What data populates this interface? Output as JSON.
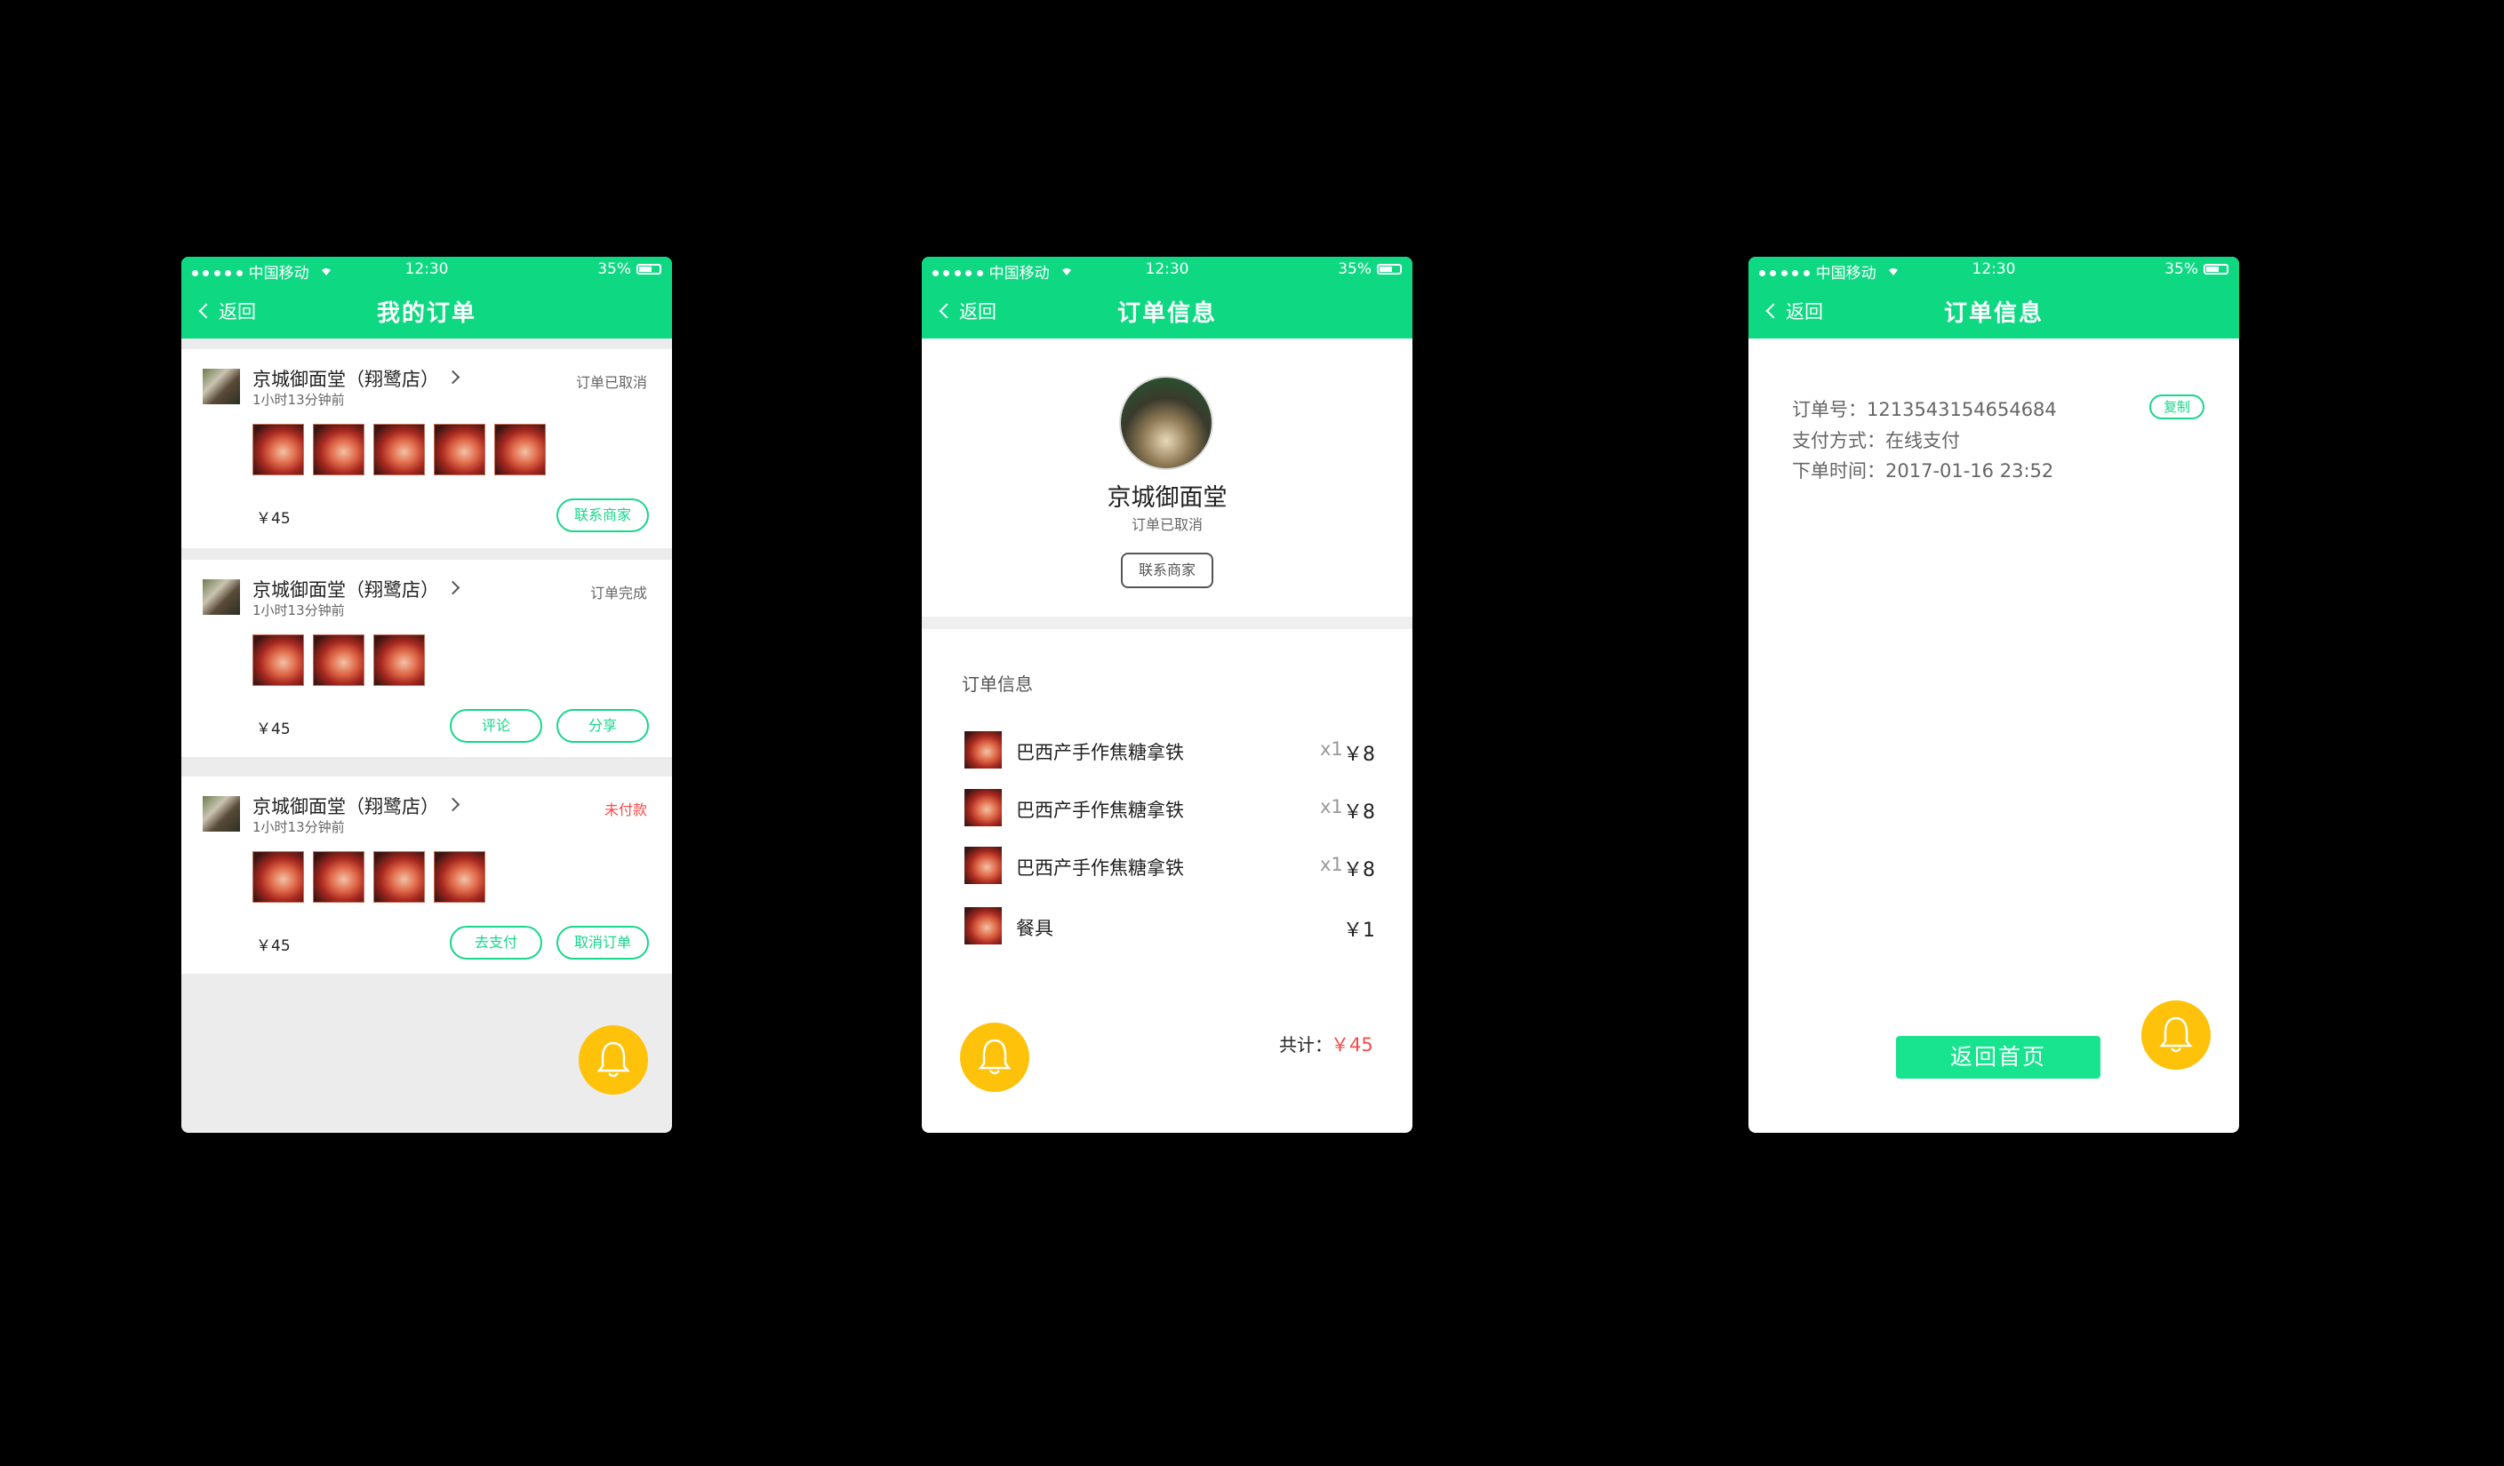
{
  "status_bar": {
    "carrier": "中国移动",
    "time": "12:30",
    "battery": "35%"
  },
  "back_label": "返回",
  "screen1": {
    "title": "我的订单",
    "orders": [
      {
        "shop": "京城御面堂（翔鹭店）",
        "time": "1小时13分钟前",
        "status": "订单已取消",
        "price": "￥45",
        "buttons": [
          "联系商家"
        ]
      },
      {
        "shop": "京城御面堂（翔鹭店）",
        "time": "1小时13分钟前",
        "status": "订单完成",
        "price": "￥45",
        "buttons": [
          "评论",
          "分享"
        ]
      },
      {
        "shop": "京城御面堂（翔鹭店）",
        "time": "1小时13分钟前",
        "status": "未付款",
        "price": "￥45",
        "buttons": [
          "去支付",
          "取消订单"
        ]
      }
    ]
  },
  "screen2": {
    "title": "订单信息",
    "shop_name": "京城御面堂",
    "status": "订单已取消",
    "contact_label": "联系商家",
    "section_title": "订单信息",
    "items": [
      {
        "name": "巴西产手作焦糖拿铁",
        "qty": "x1",
        "price": "￥8"
      },
      {
        "name": "巴西产手作焦糖拿铁",
        "qty": "x1",
        "price": "￥8"
      },
      {
        "name": "巴西产手作焦糖拿铁",
        "qty": "x1",
        "price": "￥8"
      },
      {
        "name": "餐具",
        "qty": "",
        "price": "￥1"
      }
    ],
    "total_label": "共计：",
    "total_value": "￥45"
  },
  "screen3": {
    "title": "订单信息",
    "order_no": "订单号：1213543154654684",
    "copy_label": "复制",
    "pay_method": "支付方式：在线支付",
    "order_time": "下单时间：2017-01-16  23:52",
    "home_label": "返回首页"
  },
  "colors": {
    "accent": "#0fd883",
    "button_green": "#18d68a",
    "alert_red": "#f44b4b",
    "bell_yellow": "#fec20a"
  },
  "icons": [
    "signal-dots-icon",
    "wifi-icon",
    "battery-icon",
    "back-chevron-icon",
    "chevron-right-icon",
    "bell-icon"
  ]
}
